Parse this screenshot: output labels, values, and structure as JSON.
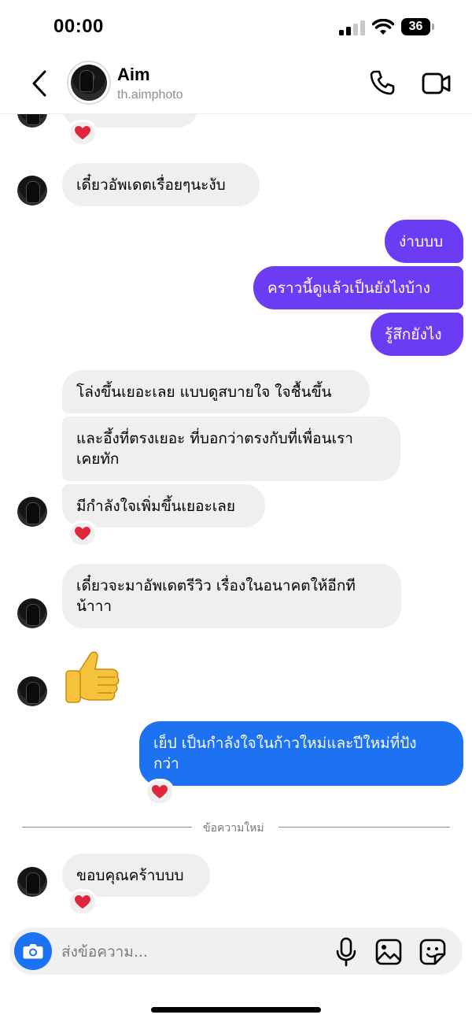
{
  "status_bar": {
    "time": "00:00",
    "battery": "36"
  },
  "header": {
    "name": "Aim",
    "username": "th.aimphoto"
  },
  "messages": {
    "m1": "เดี๋ยวอัพเดตเรื่อยๆนะงับ",
    "m2": "ง่าบบบ",
    "m3": "คราวนี้ดูแล้วเป็นยังไงบ้าง",
    "m4": "รู้สึกยังไง",
    "m5": "โล่งขึ้นเยอะเลย แบบดูสบายใจ ใจชื้นขึ้น",
    "m6": "และอึ้งที่ตรงเยอะ ที่บอกว่าตรงกับที่เพื่อนเรา\nเคยทัก",
    "m7": "มีกำลังใจเพิ่มขึ้นเยอะเลย",
    "m8": "เดี๋ยวจะมาอัพเดตรีวิว เรื่องในอนาคตให้อีกที\nน้าาา",
    "m9": "เย็ป เป็นกำลังใจในก้าวใหม่และปีใหม่ที่ปัง\nกว่า",
    "m10": "ขอบคุณคร้าบบบ"
  },
  "divider": {
    "label": "ข้อความใหม่"
  },
  "composer": {
    "placeholder": "ส่งข้อความ..."
  },
  "colors": {
    "outgoing_purple": "#6c3cf5",
    "outgoing_blue": "#1d72f2",
    "incoming": "#efefef",
    "reaction_heart": "#e0263c"
  },
  "icons": [
    "back-chevron-icon",
    "phone-icon",
    "video-camera-icon",
    "heart-reaction-icon",
    "thumbs-up-emoji",
    "camera-icon",
    "microphone-icon",
    "gallery-icon",
    "sticker-icon"
  ]
}
